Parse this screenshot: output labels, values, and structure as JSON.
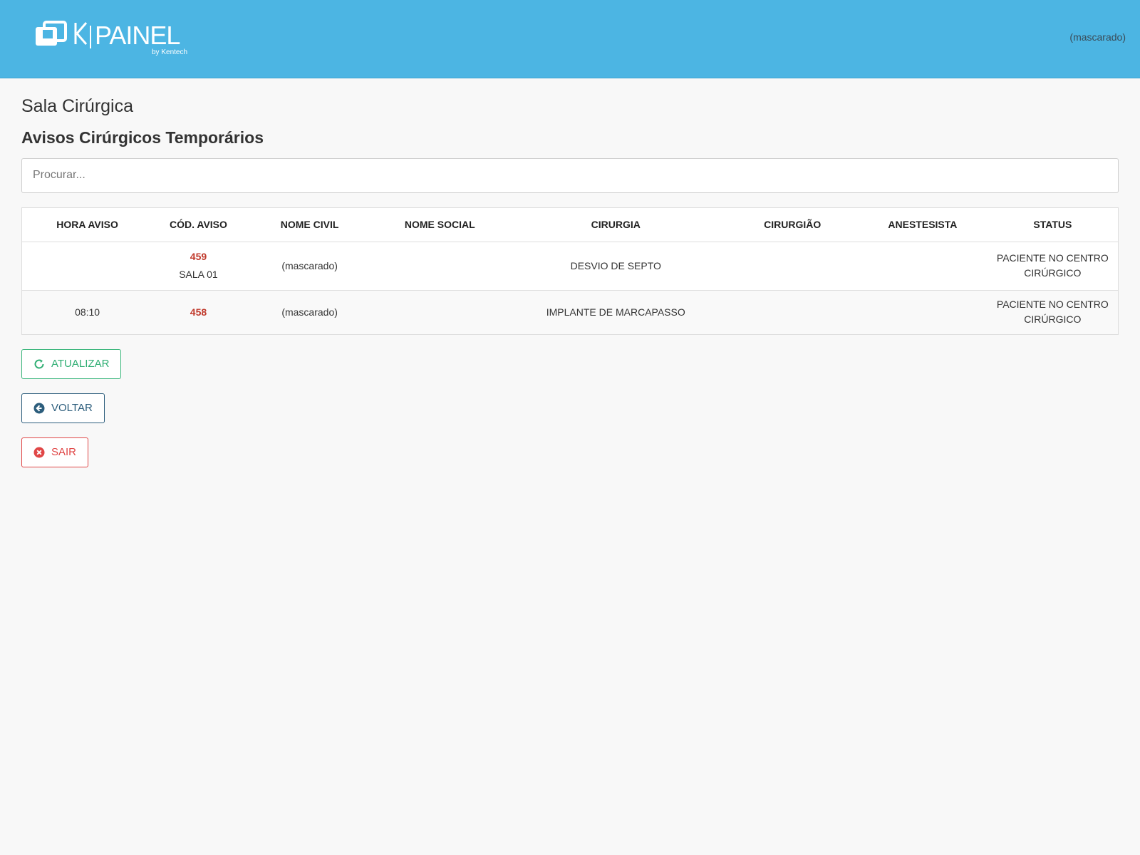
{
  "header": {
    "logo_alt": "KPAINEL by Kentech",
    "user": "(mascarado)"
  },
  "page": {
    "title": "Sala Cirúrgica",
    "section_title": "Avisos Cirúrgicos Temporários"
  },
  "search": {
    "placeholder": "Procurar...",
    "value": ""
  },
  "table": {
    "columns": [
      "HORA AVISO",
      "CÓD. AVISO",
      "NOME CIVIL",
      "NOME SOCIAL",
      "CIRURGIA",
      "CIRURGIÃO",
      "ANESTESISTA",
      "STATUS"
    ],
    "rows": [
      {
        "hora": "",
        "codigo": "459",
        "sala": "SALA 01",
        "nome_civil": "(mascarado)",
        "nome_social": "",
        "cirurgia": "DESVIO DE SEPTO",
        "cirurgiao": "",
        "anestesista": "",
        "status": "PACIENTE NO CENTRO CIRÚRGICO"
      },
      {
        "hora": "08:10",
        "codigo": "458",
        "sala": "",
        "nome_civil": "(mascarado)",
        "nome_social": "",
        "cirurgia": "IMPLANTE DE MARCAPASSO",
        "cirurgiao": "",
        "anestesista": "",
        "status": "PACIENTE NO CENTRO CIRÚRGICO"
      }
    ]
  },
  "buttons": {
    "atualizar": "ATUALIZAR",
    "voltar": "VOLTAR",
    "sair": "SAIR"
  },
  "icons": {
    "atualizar": "refresh-icon",
    "voltar": "arrow-circle-left-icon",
    "sair": "times-circle-icon"
  },
  "colors": {
    "header_bg": "#4cb5e3",
    "code_red": "#c0392b",
    "success": "#2fae73",
    "primary": "#2c5d7c",
    "danger": "#e04646"
  }
}
